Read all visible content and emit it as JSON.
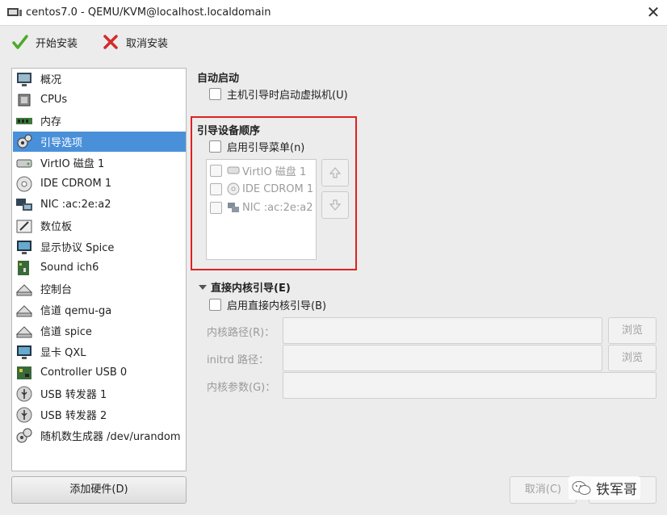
{
  "window": {
    "title": "centos7.0 - QEMU/KVM@localhost.localdomain",
    "close": "✕"
  },
  "toolbar": {
    "begin_install": "开始安装",
    "cancel_install": "取消安装"
  },
  "sidebar": {
    "items": [
      {
        "label": "概况",
        "icon": "overview-icon"
      },
      {
        "label": "CPUs",
        "icon": "cpu-icon"
      },
      {
        "label": "内存",
        "icon": "memory-icon"
      },
      {
        "label": "引导选项",
        "icon": "boot-options-icon",
        "selected": true
      },
      {
        "label": "VirtIO 磁盘 1",
        "icon": "disk-icon"
      },
      {
        "label": "IDE CDROM 1",
        "icon": "cdrom-icon"
      },
      {
        "label": "NIC :ac:2e:a2",
        "icon": "network-icon"
      },
      {
        "label": "数位板",
        "icon": "tablet-icon"
      },
      {
        "label": "显示协议 Spice",
        "icon": "display-icon"
      },
      {
        "label": "Sound ich6",
        "icon": "sound-icon"
      },
      {
        "label": "控制台",
        "icon": "console-icon"
      },
      {
        "label": "信道 qemu-ga",
        "icon": "channel-icon"
      },
      {
        "label": "信道 spice",
        "icon": "channel-icon"
      },
      {
        "label": "显卡 QXL",
        "icon": "video-icon"
      },
      {
        "label": "Controller USB 0",
        "icon": "controller-icon"
      },
      {
        "label": "USB 转发器 1",
        "icon": "usb-redirector-icon"
      },
      {
        "label": "USB 转发器 2",
        "icon": "usb-redirector-icon"
      },
      {
        "label": "随机数生成器 /dev/urandom",
        "icon": "rng-icon"
      }
    ],
    "add_hardware": "添加硬件(D)"
  },
  "autostart": {
    "title": "自动启动",
    "checkbox": "主机引导时启动虚拟机(U)",
    "checked": false
  },
  "boot_order": {
    "title": "引导设备顺序",
    "enable_menu": "启用引导菜单(n)",
    "enable_menu_checked": false,
    "devices": [
      {
        "label": "VirtIO 磁盘 1",
        "icon": "disk-icon",
        "checked": false
      },
      {
        "label": "IDE CDROM 1",
        "icon": "cdrom-icon",
        "checked": false
      },
      {
        "label": "NIC :ac:2e:a2",
        "icon": "network-icon",
        "checked": false
      }
    ]
  },
  "direct_kernel": {
    "title": "直接内核引导(E)",
    "enable": "启用直接内核引导(B)",
    "enable_checked": false,
    "kernel_path_label": "内核路径(R)：",
    "initrd_path_label": "initrd 路径：",
    "kernel_args_label": "内核参数(G)：",
    "browse": "浏览",
    "kernel_path_value": "",
    "initrd_path_value": "",
    "kernel_args_value": ""
  },
  "footer": {
    "cancel": "取消(C)",
    "watermark": "铁军哥"
  },
  "colors": {
    "selection": "#4a90d9",
    "highlight_border": "#e02020"
  }
}
